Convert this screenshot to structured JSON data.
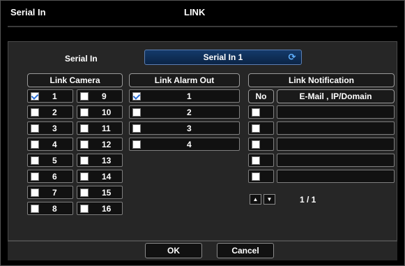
{
  "window": {
    "title": "Serial In",
    "heading": "LINK"
  },
  "serial_in": {
    "label": "Serial In",
    "value": "Serial In 1"
  },
  "link_camera": {
    "header": "Link Camera",
    "items": [
      {
        "label": "1",
        "checked": true
      },
      {
        "label": "2",
        "checked": false
      },
      {
        "label": "3",
        "checked": false
      },
      {
        "label": "4",
        "checked": false
      },
      {
        "label": "5",
        "checked": false
      },
      {
        "label": "6",
        "checked": false
      },
      {
        "label": "7",
        "checked": false
      },
      {
        "label": "8",
        "checked": false
      },
      {
        "label": "9",
        "checked": false
      },
      {
        "label": "10",
        "checked": false
      },
      {
        "label": "11",
        "checked": false
      },
      {
        "label": "12",
        "checked": false
      },
      {
        "label": "13",
        "checked": false
      },
      {
        "label": "14",
        "checked": false
      },
      {
        "label": "15",
        "checked": false
      },
      {
        "label": "16",
        "checked": false
      }
    ]
  },
  "link_alarm_out": {
    "header": "Link Alarm Out",
    "items": [
      {
        "label": "1",
        "checked": true
      },
      {
        "label": "2",
        "checked": false
      },
      {
        "label": "3",
        "checked": false
      },
      {
        "label": "4",
        "checked": false
      }
    ]
  },
  "link_notification": {
    "header": "Link Notification",
    "col_no": "No",
    "col_target": "E-Mail , IP/Domain",
    "rows": [
      {
        "checked": false,
        "target": ""
      },
      {
        "checked": false,
        "target": ""
      },
      {
        "checked": false,
        "target": ""
      },
      {
        "checked": false,
        "target": ""
      },
      {
        "checked": false,
        "target": ""
      }
    ],
    "page_indicator": "1 / 1"
  },
  "buttons": {
    "ok": "OK",
    "cancel": "Cancel"
  },
  "icons": {
    "combo": "refresh-icon",
    "up": "arrow-up-icon",
    "down": "arrow-down-icon"
  },
  "colors": {
    "accent": "#2b6fd6",
    "combo_bg": "#143a6a",
    "panel_bg": "#262626"
  }
}
